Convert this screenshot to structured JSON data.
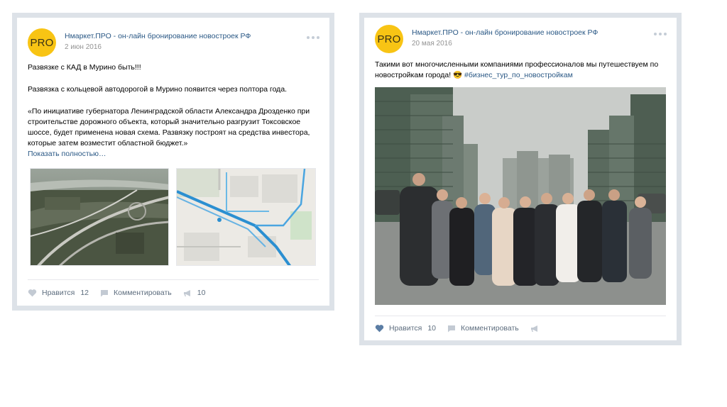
{
  "posts": [
    {
      "avatar_text": "PRO",
      "author": "Нмаркет.ПРО - он-лайн бронирование новостроек РФ",
      "date": "2 июн 2016",
      "paragraphs": [
        "Развязке с КАД в Мурино быть!!!",
        "Развязка с кольцевой автодорогой в Мурино появится через полтора года.",
        "«По инициативе губернатора Ленинградской области Александра Дрозденко при строительстве дорожного объекта, который значительно разгрузит Токсовское шоссе, будет применена новая схема. Развязку построят на средства инвестора, которые затем возместит областной бюджет.»"
      ],
      "show_more": "Показать полностью…",
      "like_label": "Нравится",
      "like_count": "12",
      "comment_label": "Комментировать",
      "share_count": "10"
    },
    {
      "avatar_text": "PRO",
      "author": "Нмаркет.ПРО - он-лайн бронирование новостроек РФ",
      "date": "20 мая 2016",
      "text_main": "Такими вот многочисленными компаниями профессионалов мы путешествуем по новостройкам города! 😎",
      "hashtag": "#бизнес_тур_по_новостройкам",
      "like_label": "Нравится",
      "like_count": "10",
      "comment_label": "Комментировать"
    }
  ],
  "colors": {
    "link": "#2a5885",
    "avatar": "#f8c414",
    "muted": "#939393",
    "action": "#5d6d7e"
  }
}
